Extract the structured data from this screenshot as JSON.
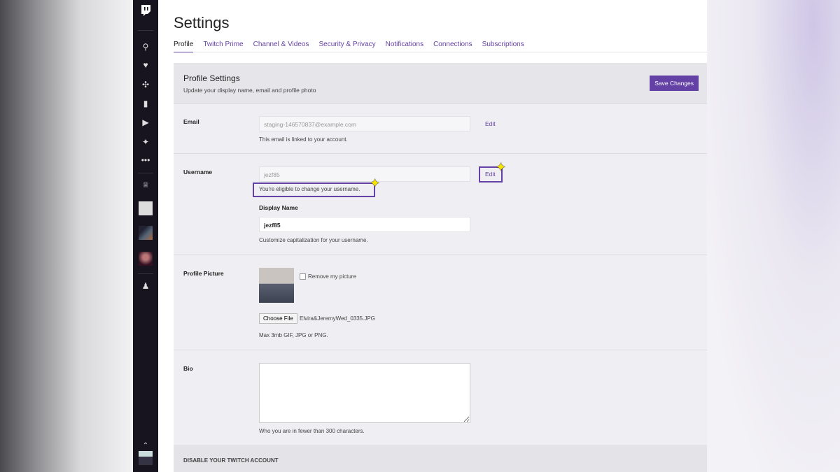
{
  "sidebar": {
    "icons": [
      "twitch-logo",
      "search",
      "heart",
      "games",
      "video",
      "play",
      "sparkle",
      "more",
      "crown",
      "channel-avatar",
      "channel-avatar",
      "channel-avatar",
      "friends",
      "chevron-up",
      "user-avatar"
    ]
  },
  "page": {
    "title": "Settings"
  },
  "tabs": [
    {
      "label": "Profile",
      "active": true
    },
    {
      "label": "Twitch Prime"
    },
    {
      "label": "Channel & Videos"
    },
    {
      "label": "Security & Privacy"
    },
    {
      "label": "Notifications"
    },
    {
      "label": "Connections"
    },
    {
      "label": "Subscriptions"
    }
  ],
  "profile": {
    "title": "Profile Settings",
    "subtitle": "Update your display name, email and profile photo",
    "save_label": "Save Changes"
  },
  "email": {
    "label": "Email",
    "value": "staging-146570837@example.com",
    "help": "This email is linked to your account.",
    "edit": "Edit"
  },
  "username": {
    "label": "Username",
    "value": "jezf85",
    "eligible": "You're eligible to change your username.",
    "edit": "Edit",
    "display_label": "Display Name",
    "display_value": "jezf85",
    "display_help": "Customize capitalization for your username."
  },
  "picture": {
    "label": "Profile Picture",
    "remove": "Remove my picture",
    "choose": "Choose File",
    "filename": "Elvira&JeremyWed_0335.JPG",
    "help": "Max 3mb GIF, JPG or PNG."
  },
  "bio": {
    "label": "Bio",
    "value": "",
    "help": "Who you are in fewer than 300 characters."
  },
  "disable": {
    "title": "DISABLE YOUR TWITCH ACCOUNT"
  },
  "colors": {
    "accent": "#6441a4",
    "highlight": "#f5e400"
  }
}
